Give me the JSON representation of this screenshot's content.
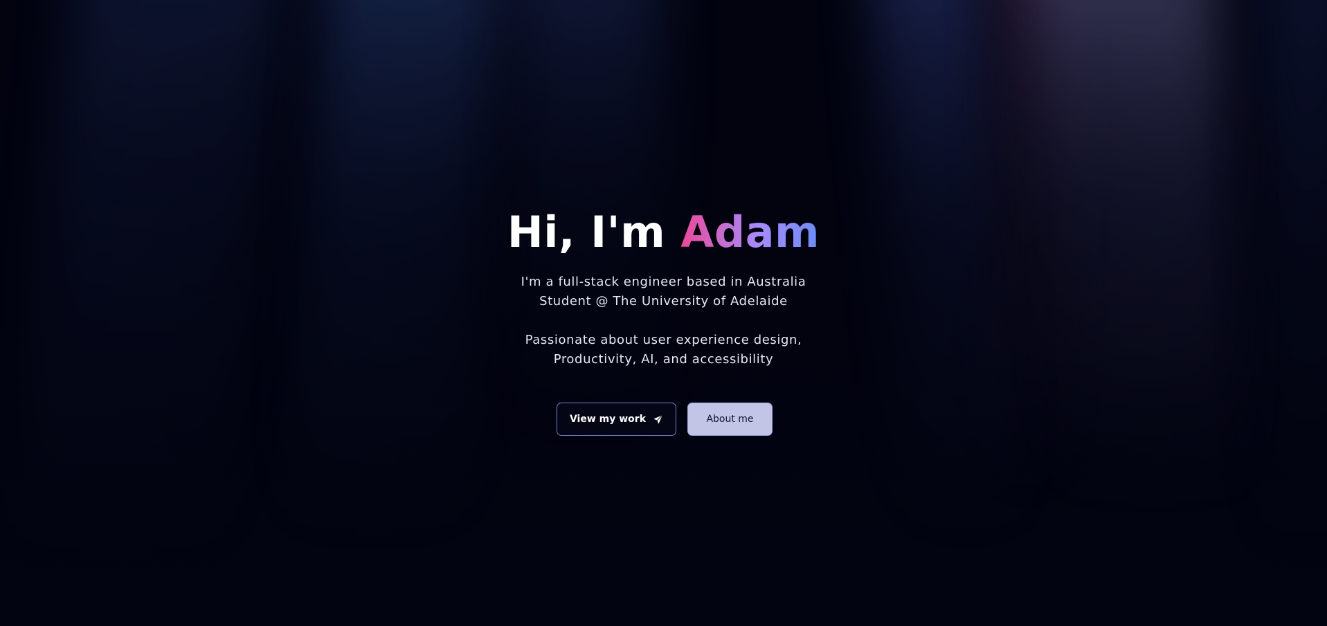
{
  "hero": {
    "greeting": "Hi, I'm",
    "name": "Adam",
    "intro_line_1": "I'm a full-stack engineer based in Australia",
    "intro_line_2": "Student @ The University of Adelaide",
    "passion_line_1": "Passionate about user experience design,",
    "passion_line_2": "Productivity, AI, and accessibility"
  },
  "actions": {
    "primary_label": "View my work",
    "primary_icon": "paper-plane-icon",
    "secondary_label": "About me"
  },
  "colors": {
    "background": "#02030f",
    "name_gradient_start": "#ec4899",
    "name_gradient_mid": "#a78bfa",
    "name_gradient_end": "#6d8cf6",
    "primary_button_border": "#7c7fc8",
    "secondary_button_bg": "#c3c5e6"
  }
}
